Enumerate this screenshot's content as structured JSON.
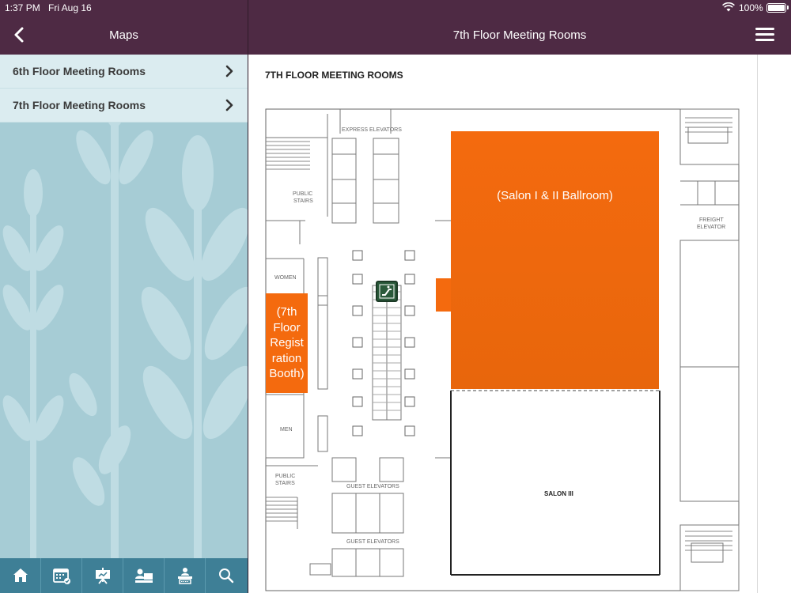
{
  "status": {
    "time": "1:37 PM",
    "date": "Fri Aug 16",
    "battery": "100%"
  },
  "sidebar": {
    "title": "Maps",
    "items": [
      {
        "label": "6th Floor Meeting Rooms"
      },
      {
        "label": "7th Floor Meeting Rooms"
      }
    ]
  },
  "main": {
    "title": "7th Floor Meeting Rooms",
    "map": {
      "heading": "7TH FLOOR MEETING ROOMS",
      "salon12": "(Salon I & II Ballroom)",
      "registration": "(7th Floor Regist ration Booth)",
      "salon3": "SALON III",
      "labels": {
        "express_elevators": "EXPRESS ELEVATORS",
        "public_stairs_top_1": "PUBLIC",
        "public_stairs_top_2": "STAIRS",
        "women": "WOMEN",
        "men": "MEN",
        "public_stairs_bot_1": "PUBLIC",
        "public_stairs_bot_2": "STAIRS",
        "guest_elevators_1": "GUEST ELEVATORS",
        "guest_elevators_2": "GUEST ELEVATORS",
        "freight_1": "FREIGHT",
        "freight_2": "ELEVATOR"
      }
    }
  },
  "tabs": [
    {
      "icon": "home-icon"
    },
    {
      "icon": "calendar-icon"
    },
    {
      "icon": "presentation-icon"
    },
    {
      "icon": "attendees-icon"
    },
    {
      "icon": "exhibitor-icon"
    },
    {
      "icon": "search-icon"
    }
  ],
  "colors": {
    "brand": "#4e2a44",
    "accent": "#f46a0e",
    "sidebar_bg": "#a6ccd5",
    "tabbar": "#3e7f96"
  }
}
